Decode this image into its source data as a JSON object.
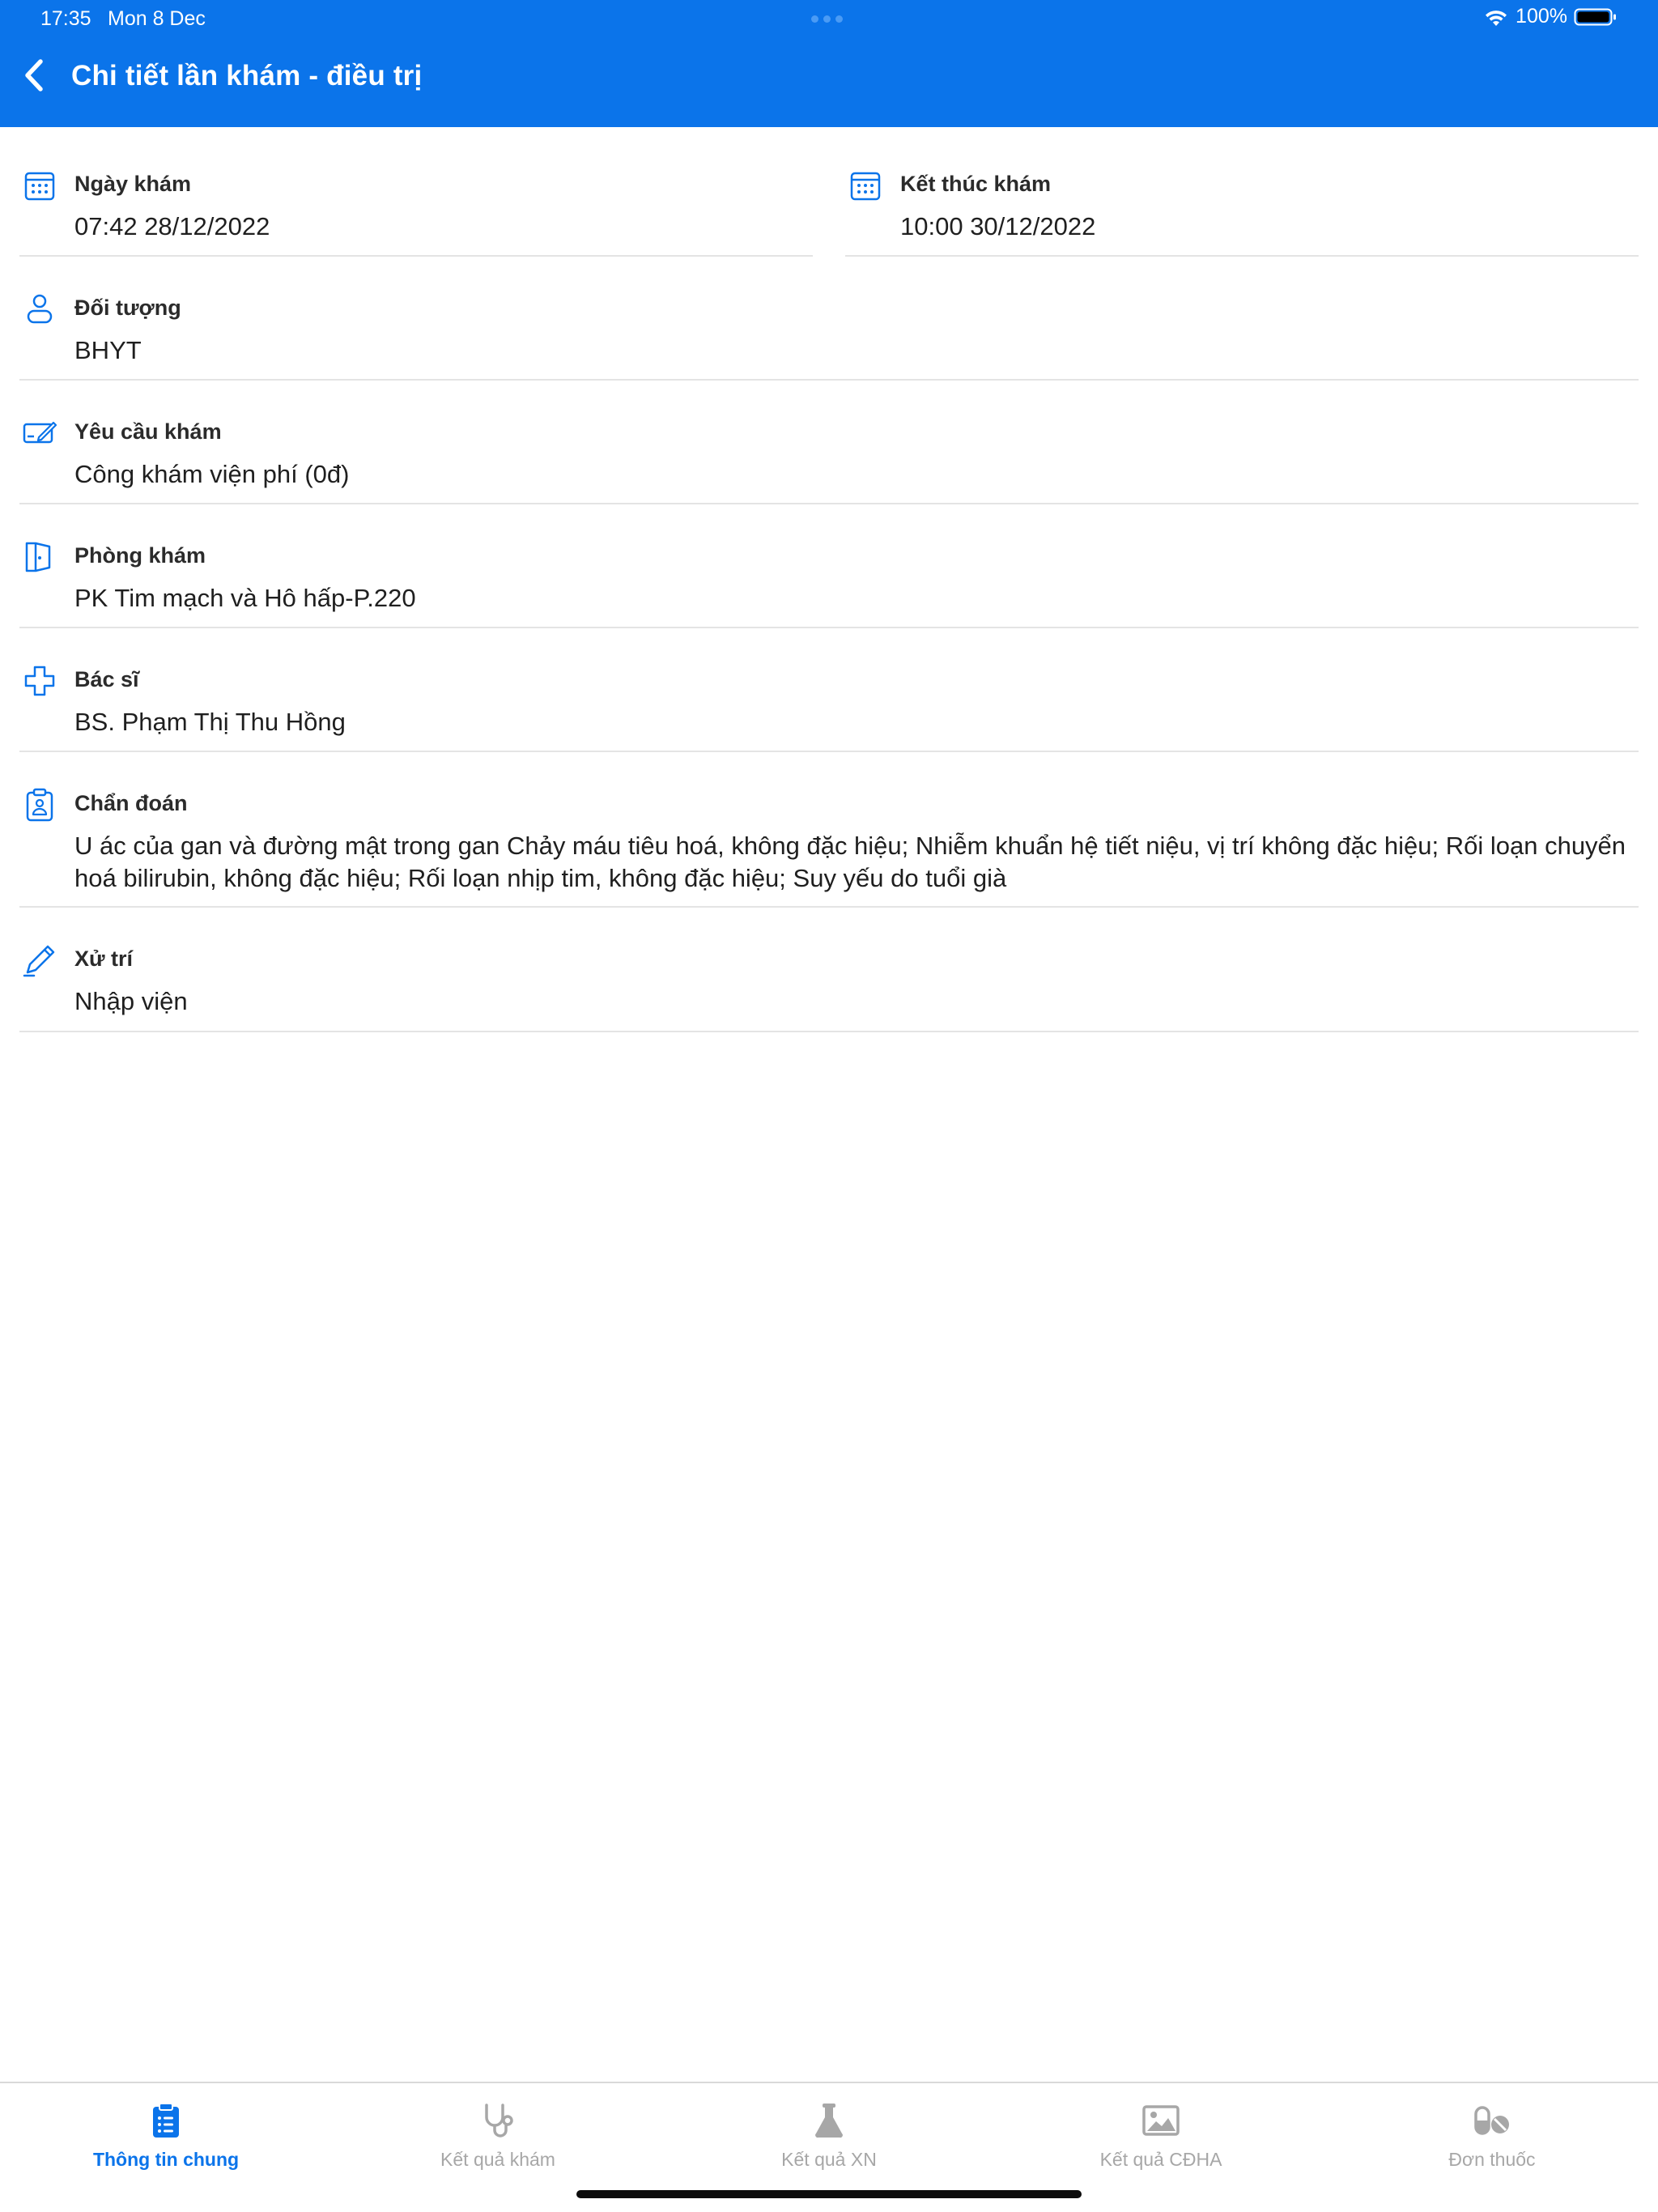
{
  "status_bar": {
    "time": "17:35",
    "date": "Mon 8 Dec",
    "battery": "100%"
  },
  "header": {
    "title": "Chi tiết lần khám - điều trị"
  },
  "fields": {
    "ngay_kham": {
      "label": "Ngày khám",
      "value": "07:42 28/12/2022",
      "icon": "calendar-icon"
    },
    "ket_thuc_kham": {
      "label": "Kết thúc khám",
      "value": "10:00 30/12/2022",
      "icon": "calendar-icon"
    },
    "doi_tuong": {
      "label": "Đối tượng",
      "value": "BHYT",
      "icon": "person-icon"
    },
    "yeu_cau_kham": {
      "label": "Yêu cầu khám",
      "value": "Công khám viện phí (0đ)",
      "icon": "card-edit-icon"
    },
    "phong_kham": {
      "label": "Phòng khám",
      "value": "PK Tim mạch và Hô hấp-P.220",
      "icon": "door-icon"
    },
    "bac_si": {
      "label": "Bác sĩ",
      "value": "BS. Phạm Thị Thu Hồng",
      "icon": "medical-cross-icon"
    },
    "chan_doan": {
      "label": "Chẩn đoán",
      "value": "U ác của gan và đường mật trong gan Chảy máu tiêu hoá, không đặc hiệu; Nhiễm khuẩn hệ tiết niệu, vị trí không đặc hiệu; Rối loạn chuyển hoá bilirubin, không đặc hiệu; Rối loạn nhịp tim, không đặc hiệu; Suy yếu do tuổi già",
      "icon": "clipboard-person-icon"
    },
    "xu_tri": {
      "label": "Xử trí",
      "value": "Nhập viện",
      "icon": "pen-icon"
    }
  },
  "tabs": [
    {
      "label": "Thông tin chung",
      "icon": "clipboard-list-icon",
      "active": true
    },
    {
      "label": "Kết quả khám",
      "icon": "stethoscope-icon",
      "active": false
    },
    {
      "label": "Kết quả XN",
      "icon": "flask-icon",
      "active": false
    },
    {
      "label": "Kết quả CĐHA",
      "icon": "image-icon",
      "active": false
    },
    {
      "label": "Đơn thuốc",
      "icon": "pills-icon",
      "active": false
    }
  ],
  "colors": {
    "primary": "#0b74ea",
    "inactive": "#a7a7a7",
    "divider": "#e4e4e4"
  }
}
